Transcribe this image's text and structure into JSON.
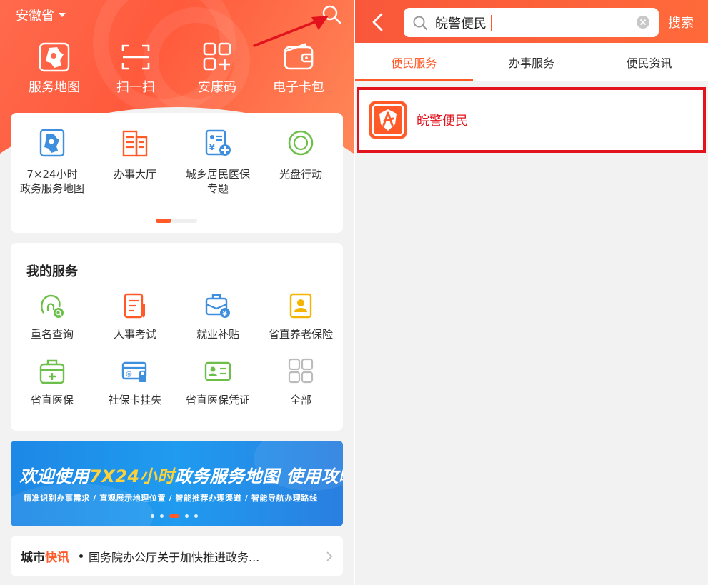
{
  "left": {
    "location": "安徽省",
    "quick_actions": [
      {
        "label": "服务地图",
        "icon": "anhui-map-icon"
      },
      {
        "label": "扫一扫",
        "icon": "scan-icon"
      },
      {
        "label": "安康码",
        "icon": "qr-grid-icon"
      },
      {
        "label": "电子卡包",
        "icon": "wallet-icon"
      }
    ],
    "featured": [
      {
        "label_line1": "7×24小时",
        "label_line2": "政务服务地图",
        "icon": "map-marker-icon"
      },
      {
        "label_line1": "办事大厅",
        "label_line2": "",
        "icon": "building-icon"
      },
      {
        "label_line1": "城乡居民医保",
        "label_line2": "专题",
        "icon": "medical-insurance-icon"
      },
      {
        "label_line1": "光盘行动",
        "label_line2": "",
        "icon": "clean-plate-icon"
      }
    ],
    "my_services": {
      "title": "我的服务",
      "items": [
        {
          "label": "重名查询",
          "icon": "name-search-icon"
        },
        {
          "label": "人事考试",
          "icon": "exam-icon"
        },
        {
          "label": "就业补贴",
          "icon": "employment-subsidy-icon"
        },
        {
          "label": "省直养老保险",
          "icon": "pension-icon"
        },
        {
          "label": "省直医保",
          "icon": "medical-kit-icon"
        },
        {
          "label": "社保卡挂失",
          "icon": "social-card-lock-icon"
        },
        {
          "label": "省直医保凭证",
          "icon": "insurance-voucher-icon"
        },
        {
          "label": "全部",
          "icon": "all-grid-icon"
        }
      ]
    },
    "banner": {
      "title_a": "欢迎使用",
      "title_hl": "7X24小时",
      "title_b": "政务服务地图 使用攻略",
      "subtitle": "精准识别办事需求 / 直观展示地理位置 / 智能推荐办理渠道 / 智能导航办理路线"
    },
    "news": {
      "tag_a": "城市",
      "tag_b": "快讯",
      "headline": "国务院办公厅关于加快推进政务..."
    }
  },
  "right": {
    "search": {
      "value": "皖警便民",
      "button": "搜索"
    },
    "tabs": [
      {
        "label": "便民服务",
        "active": true
      },
      {
        "label": "办事服务",
        "active": false
      },
      {
        "label": "便民资讯",
        "active": false
      }
    ],
    "result": {
      "name": "皖警便民",
      "icon": "anhui-police-app-icon"
    }
  },
  "colors": {
    "brand_orange": "#ff5a28",
    "highlight_red": "#e3131d",
    "icon_blue": "#3f8fdf",
    "icon_green": "#6cc04a",
    "icon_yellow": "#f5b400"
  }
}
